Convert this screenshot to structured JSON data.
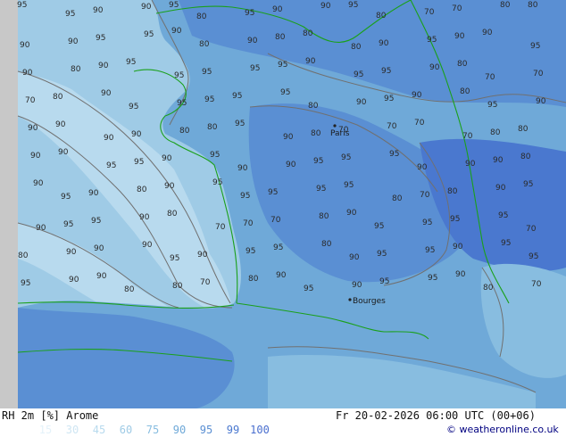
{
  "footer": {
    "product": "RH 2m [%] Arome",
    "valid": "Fr 20-02-2026 06:00 UTC (00+06)",
    "credit": "© weatheronline.co.uk"
  },
  "legend": [
    {
      "label": "15",
      "color": "#e4f2fa"
    },
    {
      "label": "30",
      "color": "#cfe6f3"
    },
    {
      "label": "45",
      "color": "#b8daee"
    },
    {
      "label": "60",
      "color": "#9fcbe6"
    },
    {
      "label": "75",
      "color": "#88bde0"
    },
    {
      "label": "90",
      "color": "#6fa9d8"
    },
    {
      "label": "95",
      "color": "#5a8fd3"
    },
    {
      "label": "99",
      "color": "#4a78cf"
    },
    {
      "label": "100",
      "color": "#4a6fcf"
    }
  ],
  "map": {
    "city_labels": [
      "Paris",
      "Bourges"
    ],
    "contour_labels": [
      "95",
      "95",
      "90",
      "90",
      "95",
      "80",
      "95",
      "90",
      "90",
      "95",
      "80",
      "70",
      "70",
      "80",
      "80",
      "90",
      "90",
      "95",
      "95",
      "90",
      "80",
      "90",
      "80",
      "80",
      "80",
      "90",
      "95",
      "90",
      "90",
      "95",
      "90",
      "80",
      "90",
      "95",
      "95",
      "95",
      "95",
      "95",
      "90",
      "95",
      "95",
      "90",
      "80",
      "70",
      "70",
      "70",
      "80",
      "90",
      "95",
      "95",
      "95",
      "95",
      "95",
      "80",
      "90",
      "95",
      "90",
      "80",
      "95",
      "90",
      "90",
      "90",
      "90",
      "90",
      "80",
      "80",
      "95",
      "90",
      "80",
      "70",
      "70",
      "70",
      "70",
      "80",
      "80",
      "90",
      "90",
      "95",
      "95",
      "90",
      "95",
      "90",
      "90",
      "95",
      "95",
      "95",
      "90",
      "90",
      "90",
      "80",
      "90",
      "95",
      "90",
      "80",
      "90",
      "95",
      "95",
      "95",
      "95",
      "95",
      "80",
      "70",
      "80",
      "90",
      "95",
      "90",
      "95",
      "95",
      "90",
      "80",
      "70",
      "70",
      "70",
      "80",
      "90",
      "95",
      "95",
      "95",
      "95",
      "70",
      "80",
      "90",
      "90",
      "90",
      "95",
      "90",
      "95",
      "95",
      "80",
      "90",
      "95",
      "95",
      "90",
      "95",
      "95",
      "95",
      "90",
      "90",
      "80",
      "80",
      "70",
      "80",
      "90",
      "95",
      "90",
      "95",
      "95",
      "90",
      "80",
      "70"
    ]
  }
}
